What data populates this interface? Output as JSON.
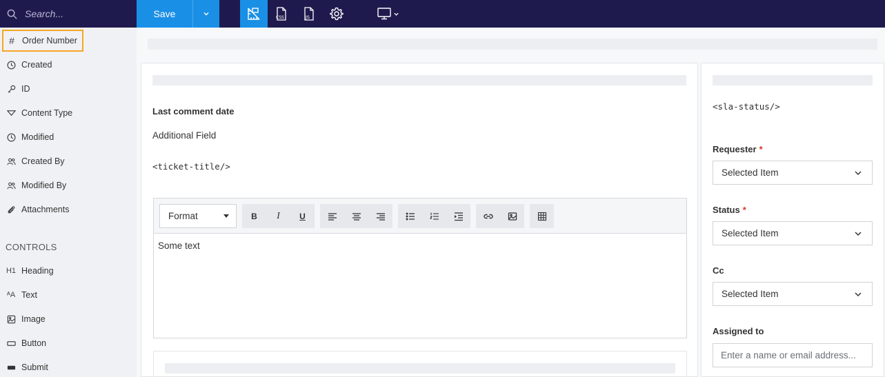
{
  "topbar": {
    "search_placeholder": "Search...",
    "save_label": "Save",
    "tools": [
      "layout-icon",
      "css-icon",
      "js-icon",
      "gear-icon"
    ],
    "device_icon": "monitor-icon"
  },
  "sidebar": {
    "fields": [
      {
        "label": "Order Number",
        "icon": "hash-icon"
      },
      {
        "label": "Created",
        "icon": "clock-icon"
      },
      {
        "label": "ID",
        "icon": "key-icon"
      },
      {
        "label": "Content Type",
        "icon": "filter-icon"
      },
      {
        "label": "Modified",
        "icon": "clock-icon"
      },
      {
        "label": "Created By",
        "icon": "users-icon"
      },
      {
        "label": "Modified By",
        "icon": "users-icon"
      },
      {
        "label": "Attachments",
        "icon": "paperclip-icon"
      }
    ],
    "controls_heading": "CONTROLS",
    "controls": [
      {
        "label": "Heading",
        "icon_text": "H1"
      },
      {
        "label": "Text",
        "icon_text": "ᴬA"
      },
      {
        "label": "Image",
        "icon": "image-icon"
      },
      {
        "label": "Button",
        "icon": "button-icon"
      },
      {
        "label": "Submit",
        "icon": "submit-icon"
      }
    ]
  },
  "main": {
    "last_comment_label": "Last comment date",
    "additional_field": "Additional Field",
    "ticket_title_tag": "<ticket-title/>",
    "editor": {
      "format_label": "Format",
      "body_text": "Some text"
    }
  },
  "right": {
    "sla_tag": "<sla-status/>",
    "requester_label": "Requester",
    "requester_value": "Selected Item",
    "status_label": "Status",
    "status_value": "Selected Item",
    "cc_label": "Cc",
    "cc_value": "Selected Item",
    "assigned_label": "Assigned to",
    "assigned_placeholder": "Enter a name or email address...",
    "required_mark": "*"
  },
  "colors": {
    "topbar": "#1f1a4e",
    "accent": "#1a8fe6",
    "highlight": "#f5a623",
    "required": "#d9342b"
  }
}
